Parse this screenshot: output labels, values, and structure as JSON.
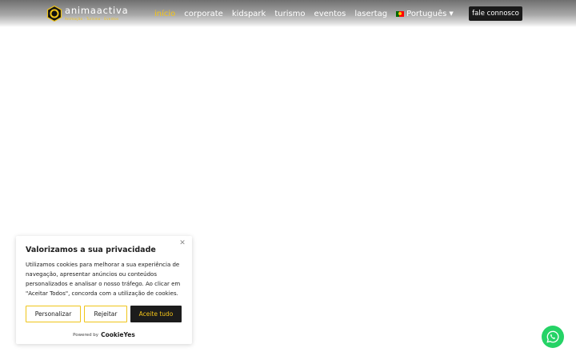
{
  "header": {
    "logo": {
      "word": "animaactiva",
      "tagline": "Animação · Turismo · Eventos"
    },
    "nav": [
      {
        "label": "início",
        "active": true
      },
      {
        "label": "corporate",
        "active": false
      },
      {
        "label": "kidspark",
        "active": false
      },
      {
        "label": "turismo",
        "active": false
      },
      {
        "label": "eventos",
        "active": false
      },
      {
        "label": "lasertag",
        "active": false
      }
    ],
    "language": {
      "label": "Português",
      "flag": "portugal-flag-icon"
    },
    "cta_label": "fale connosco"
  },
  "cookie_banner": {
    "title": "Valorizamos a sua privacidade",
    "body": "Utilizamos cookies para melhorar a sua experiência de navegação, apresentar anúncios ou conteúdos personalizados e analisar o nosso tráfego. Ao clicar em \"Aceitar Todos\", concorda com a utilização de cookies.",
    "buttons": {
      "customize": "Personalizar",
      "reject": "Rejeitar",
      "accept": "Aceite tudo"
    },
    "powered_by": "Powered by",
    "powered_brand": "CookieYes",
    "close_icon": "close-icon"
  },
  "floating": {
    "whatsapp_icon": "whatsapp-icon"
  },
  "colors": {
    "accent": "#f5c518",
    "dark": "#1c1c1c",
    "whatsapp": "#25d366"
  }
}
